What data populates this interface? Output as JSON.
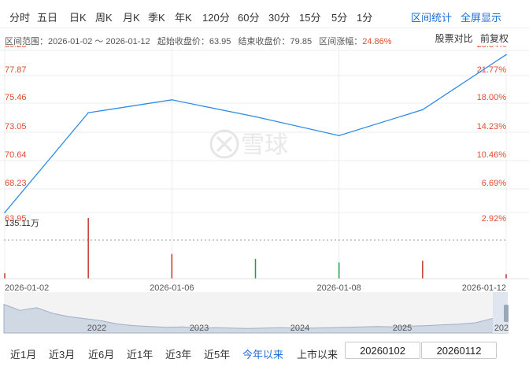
{
  "tabs": [
    {
      "label": "分时"
    },
    {
      "label": "五日"
    },
    {
      "label": "日K"
    },
    {
      "label": "周K"
    },
    {
      "label": "月K"
    },
    {
      "label": "季K"
    },
    {
      "label": "年K"
    },
    {
      "label": "120分"
    },
    {
      "label": "60分"
    },
    {
      "label": "30分"
    },
    {
      "label": "15分"
    },
    {
      "label": "5分"
    },
    {
      "label": "1分"
    }
  ],
  "actions": {
    "range_stats": "区间统计",
    "fullscreen": "全屏显示"
  },
  "info": {
    "range_label": "区间范围：",
    "range_value": "2026-01-02 ～ 2026-01-12",
    "start_label": "起始收盘价：",
    "start_value": "63.95",
    "end_label": "结束收盘价：",
    "end_value": "79.85",
    "change_label": "区间涨幅：",
    "change_value": "24.86%"
  },
  "links": {
    "compare": "股票对比",
    "adjust": "前复权"
  },
  "chart_data": {
    "type": "line",
    "x": [
      "2026-01-02",
      "2026-01-05",
      "2026-01-06",
      "2026-01-07",
      "2026-01-08",
      "2026-01-09",
      "2026-01-12"
    ],
    "series": [
      {
        "values": [
          63.95,
          74.0,
          75.3,
          73.6,
          71.7,
          74.3,
          79.85
        ]
      }
    ],
    "ylim": [
      63.95,
      80.28
    ],
    "y_ticks_left": [
      "80.28",
      "77.87",
      "75.46",
      "73.05",
      "70.64",
      "68.23",
      "63.95"
    ],
    "y_ticks_right": [
      "25.54%",
      "21.77%",
      "18.00%",
      "14.23%",
      "10.46%",
      "6.69%",
      "2.92%"
    ],
    "x_tick_labels": [
      "2026-01-02",
      "2026-01-06",
      "2026-01-08",
      "2026-01-12"
    ],
    "x_tick_indices": [
      0,
      2,
      4,
      6
    ],
    "volume_max_label": "135.11万",
    "volume": {
      "max": 135.11,
      "values": [
        12,
        135.11,
        55,
        44,
        36,
        40,
        10
      ],
      "directions": [
        "up",
        "up",
        "up",
        "down",
        "down",
        "up",
        "up"
      ]
    },
    "grid": true,
    "colors": {
      "line": "#2f8be6",
      "up": "#c0392b",
      "down": "#1e9e4a",
      "grid": "#ececec",
      "axis_text": "#e04c2f"
    },
    "watermark": "雪球"
  },
  "overview": {
    "year_labels": [
      "2022",
      "2023",
      "2024",
      "2025",
      "202"
    ],
    "profile": [
      0.7,
      0.55,
      0.62,
      0.48,
      0.4,
      0.35,
      0.3,
      0.22,
      0.18,
      0.16,
      0.14,
      0.15,
      0.12,
      0.13,
      0.12,
      0.11,
      0.12,
      0.13,
      0.12,
      0.12,
      0.13,
      0.14,
      0.15,
      0.16,
      0.15,
      0.17,
      0.18,
      0.2,
      0.22,
      0.25,
      0.35,
      0.45
    ]
  },
  "range_buttons": [
    {
      "label": "近1月"
    },
    {
      "label": "近3月"
    },
    {
      "label": "近6月"
    },
    {
      "label": "近1年"
    },
    {
      "label": "近3年"
    },
    {
      "label": "近5年"
    },
    {
      "label": "今年以来"
    },
    {
      "label": "上市以来"
    }
  ],
  "date_inputs": {
    "start": "20260102",
    "end": "20260112"
  }
}
